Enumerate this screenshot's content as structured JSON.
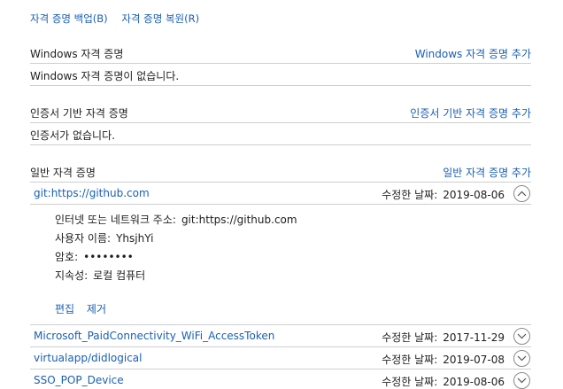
{
  "top_links": {
    "backup": "자격 증명 백업(B)",
    "restore": "자격 증명 복원(R)"
  },
  "windows_section": {
    "title": "Windows 자격 증명",
    "add": "Windows 자격 증명 추가",
    "empty": "Windows 자격 증명이 없습니다."
  },
  "cert_section": {
    "title": "인증서 기반 자격 증명",
    "add": "인증서 기반 자격 증명 추가",
    "empty": "인증서가 없습니다."
  },
  "generic_section": {
    "title": "일반 자격 증명",
    "add": "일반 자격 증명 추가",
    "modified_label": "수정한 날짜:",
    "expanded": {
      "name": "git:https://github.com",
      "modified": "2019-08-06",
      "icon": "chevron-up-icon",
      "fields": [
        {
          "key": "인터넷 또는 네트워크 주소:",
          "value": "git:https://github.com"
        },
        {
          "key": "사용자 이름:",
          "value": "YhsjhYi"
        },
        {
          "key": "암호:",
          "value": "••••••••"
        },
        {
          "key": "지속성:",
          "value": "로컬 컴퓨터"
        }
      ],
      "edit": "편집",
      "remove": "제거"
    },
    "items": [
      {
        "name": "Microsoft_PaidConnectivity_WiFi_AccessToken",
        "modified": "2017-11-29",
        "icon": "chevron-down-icon"
      },
      {
        "name": "virtualapp/didlogical",
        "modified": "2019-07-08",
        "icon": "chevron-down-icon"
      },
      {
        "name": "SSO_POP_Device",
        "modified": "2019-08-06",
        "icon": "chevron-down-icon"
      }
    ]
  },
  "colors": {
    "link": "#1a5fb4",
    "text": "#1e1e1e",
    "divider": "#cfcfcf"
  }
}
